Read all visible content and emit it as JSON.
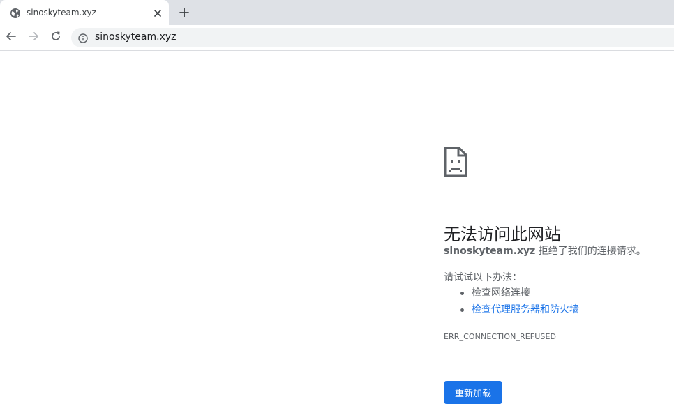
{
  "tab": {
    "title": "sinoskyteam.xyz",
    "favicon": "globe-icon",
    "close_icon": "close-icon"
  },
  "new_tab_icon": "plus-icon",
  "toolbar": {
    "back_icon": "arrow-left-icon",
    "forward_icon": "arrow-right-icon",
    "reload_icon": "reload-icon",
    "info_icon": "info-icon",
    "url": "sinoskyteam.xyz"
  },
  "error": {
    "icon": "sad-page-icon",
    "heading": "无法访问此网站",
    "domain": "sinoskyteam.xyz",
    "message": " 拒绝了我们的连接请求。",
    "try_label": "请试试以下办法：",
    "suggestions": [
      {
        "text": "检查网络连接",
        "is_link": false
      },
      {
        "text": "检查代理服务器和防火墙",
        "is_link": true
      }
    ],
    "code": "ERR_CONNECTION_REFUSED",
    "reload_label": "重新加载"
  },
  "colors": {
    "tabstrip_bg": "#dee1e6",
    "omnibox_bg": "#f1f3f4",
    "accent": "#1a73e8",
    "secondary_text": "#5f6368"
  }
}
